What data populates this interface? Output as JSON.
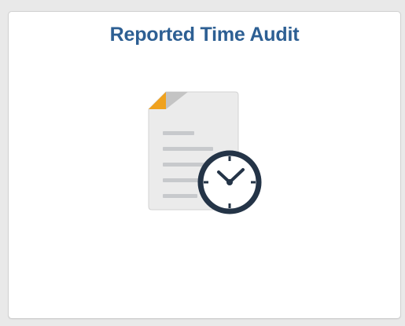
{
  "tile": {
    "title": "Reported Time Audit",
    "icon": "document-clock-icon"
  },
  "colors": {
    "title": "#2d5f93",
    "document": "#ebebeb",
    "fold_accent": "#f0a21f",
    "lines": "#c7c9cc",
    "clock_ring": "#243447",
    "clock_face": "#ffffff"
  }
}
